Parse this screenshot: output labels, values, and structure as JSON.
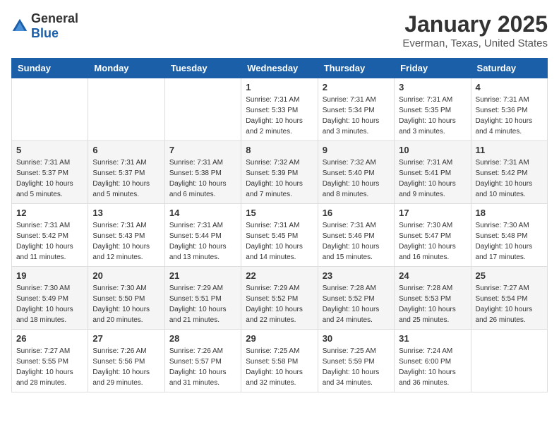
{
  "logo": {
    "general": "General",
    "blue": "Blue"
  },
  "header": {
    "title": "January 2025",
    "subtitle": "Everman, Texas, United States"
  },
  "weekdays": [
    "Sunday",
    "Monday",
    "Tuesday",
    "Wednesday",
    "Thursday",
    "Friday",
    "Saturday"
  ],
  "weeks": [
    [
      {
        "day": "",
        "info": ""
      },
      {
        "day": "",
        "info": ""
      },
      {
        "day": "",
        "info": ""
      },
      {
        "day": "1",
        "info": "Sunrise: 7:31 AM\nSunset: 5:33 PM\nDaylight: 10 hours\nand 2 minutes."
      },
      {
        "day": "2",
        "info": "Sunrise: 7:31 AM\nSunset: 5:34 PM\nDaylight: 10 hours\nand 3 minutes."
      },
      {
        "day": "3",
        "info": "Sunrise: 7:31 AM\nSunset: 5:35 PM\nDaylight: 10 hours\nand 3 minutes."
      },
      {
        "day": "4",
        "info": "Sunrise: 7:31 AM\nSunset: 5:36 PM\nDaylight: 10 hours\nand 4 minutes."
      }
    ],
    [
      {
        "day": "5",
        "info": "Sunrise: 7:31 AM\nSunset: 5:37 PM\nDaylight: 10 hours\nand 5 minutes."
      },
      {
        "day": "6",
        "info": "Sunrise: 7:31 AM\nSunset: 5:37 PM\nDaylight: 10 hours\nand 5 minutes."
      },
      {
        "day": "7",
        "info": "Sunrise: 7:31 AM\nSunset: 5:38 PM\nDaylight: 10 hours\nand 6 minutes."
      },
      {
        "day": "8",
        "info": "Sunrise: 7:32 AM\nSunset: 5:39 PM\nDaylight: 10 hours\nand 7 minutes."
      },
      {
        "day": "9",
        "info": "Sunrise: 7:32 AM\nSunset: 5:40 PM\nDaylight: 10 hours\nand 8 minutes."
      },
      {
        "day": "10",
        "info": "Sunrise: 7:31 AM\nSunset: 5:41 PM\nDaylight: 10 hours\nand 9 minutes."
      },
      {
        "day": "11",
        "info": "Sunrise: 7:31 AM\nSunset: 5:42 PM\nDaylight: 10 hours\nand 10 minutes."
      }
    ],
    [
      {
        "day": "12",
        "info": "Sunrise: 7:31 AM\nSunset: 5:42 PM\nDaylight: 10 hours\nand 11 minutes."
      },
      {
        "day": "13",
        "info": "Sunrise: 7:31 AM\nSunset: 5:43 PM\nDaylight: 10 hours\nand 12 minutes."
      },
      {
        "day": "14",
        "info": "Sunrise: 7:31 AM\nSunset: 5:44 PM\nDaylight: 10 hours\nand 13 minutes."
      },
      {
        "day": "15",
        "info": "Sunrise: 7:31 AM\nSunset: 5:45 PM\nDaylight: 10 hours\nand 14 minutes."
      },
      {
        "day": "16",
        "info": "Sunrise: 7:31 AM\nSunset: 5:46 PM\nDaylight: 10 hours\nand 15 minutes."
      },
      {
        "day": "17",
        "info": "Sunrise: 7:30 AM\nSunset: 5:47 PM\nDaylight: 10 hours\nand 16 minutes."
      },
      {
        "day": "18",
        "info": "Sunrise: 7:30 AM\nSunset: 5:48 PM\nDaylight: 10 hours\nand 17 minutes."
      }
    ],
    [
      {
        "day": "19",
        "info": "Sunrise: 7:30 AM\nSunset: 5:49 PM\nDaylight: 10 hours\nand 18 minutes."
      },
      {
        "day": "20",
        "info": "Sunrise: 7:30 AM\nSunset: 5:50 PM\nDaylight: 10 hours\nand 20 minutes."
      },
      {
        "day": "21",
        "info": "Sunrise: 7:29 AM\nSunset: 5:51 PM\nDaylight: 10 hours\nand 21 minutes."
      },
      {
        "day": "22",
        "info": "Sunrise: 7:29 AM\nSunset: 5:52 PM\nDaylight: 10 hours\nand 22 minutes."
      },
      {
        "day": "23",
        "info": "Sunrise: 7:28 AM\nSunset: 5:52 PM\nDaylight: 10 hours\nand 24 minutes."
      },
      {
        "day": "24",
        "info": "Sunrise: 7:28 AM\nSunset: 5:53 PM\nDaylight: 10 hours\nand 25 minutes."
      },
      {
        "day": "25",
        "info": "Sunrise: 7:27 AM\nSunset: 5:54 PM\nDaylight: 10 hours\nand 26 minutes."
      }
    ],
    [
      {
        "day": "26",
        "info": "Sunrise: 7:27 AM\nSunset: 5:55 PM\nDaylight: 10 hours\nand 28 minutes."
      },
      {
        "day": "27",
        "info": "Sunrise: 7:26 AM\nSunset: 5:56 PM\nDaylight: 10 hours\nand 29 minutes."
      },
      {
        "day": "28",
        "info": "Sunrise: 7:26 AM\nSunset: 5:57 PM\nDaylight: 10 hours\nand 31 minutes."
      },
      {
        "day": "29",
        "info": "Sunrise: 7:25 AM\nSunset: 5:58 PM\nDaylight: 10 hours\nand 32 minutes."
      },
      {
        "day": "30",
        "info": "Sunrise: 7:25 AM\nSunset: 5:59 PM\nDaylight: 10 hours\nand 34 minutes."
      },
      {
        "day": "31",
        "info": "Sunrise: 7:24 AM\nSunset: 6:00 PM\nDaylight: 10 hours\nand 36 minutes."
      },
      {
        "day": "",
        "info": ""
      }
    ]
  ]
}
